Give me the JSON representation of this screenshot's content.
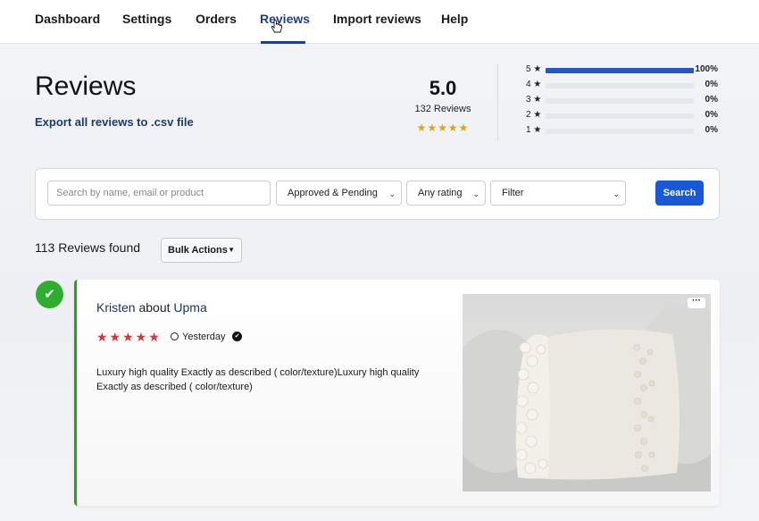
{
  "nav": {
    "items": [
      "Dashboard",
      "Settings",
      "Orders",
      "Reviews",
      "Import reviews",
      "Help"
    ],
    "active": "Reviews"
  },
  "header": {
    "title": "Reviews",
    "export_link": "Export all reviews to .csv file",
    "average_rating": "5.0",
    "review_count": "132 Reviews",
    "average_stars": "★★★★★",
    "star_color": "#e0a21a"
  },
  "rating_breakdown": [
    {
      "label": "5 ★",
      "percent": "100%",
      "fraction": 1.0
    },
    {
      "label": "4 ★",
      "percent": "0%",
      "fraction": 0
    },
    {
      "label": "3 ★",
      "percent": "0%",
      "fraction": 0
    },
    {
      "label": "2 ★",
      "percent": "0%",
      "fraction": 0
    },
    {
      "label": "1 ★",
      "percent": "0%",
      "fraction": 0
    }
  ],
  "filters": {
    "search_placeholder": "Search by name, email or product",
    "status_select": "Approved & Pending",
    "rating_select": "Any rating",
    "filter_select": "Filter",
    "search_button": "Search"
  },
  "results": {
    "found_text": "113 Reviews found",
    "bulk_actions": "Bulk Actions"
  },
  "review": {
    "reviewer": "Kristen",
    "about": "about",
    "product": "Upma",
    "stars": "★★★★★",
    "date": "Yesterday",
    "body": "Luxury high quality Exactly as described ( color/texture)Luxury high quality Exactly as described ( color/texture)",
    "more_label": "···",
    "status_icon": "check-icon",
    "accent_color": "#2f9d22"
  },
  "colors": {
    "primary": "#1859d8",
    "nav_active": "#1f3f8f",
    "bar_fill": "#2457c5",
    "approved": "#2eae2e",
    "review_star": "#d8323c"
  }
}
